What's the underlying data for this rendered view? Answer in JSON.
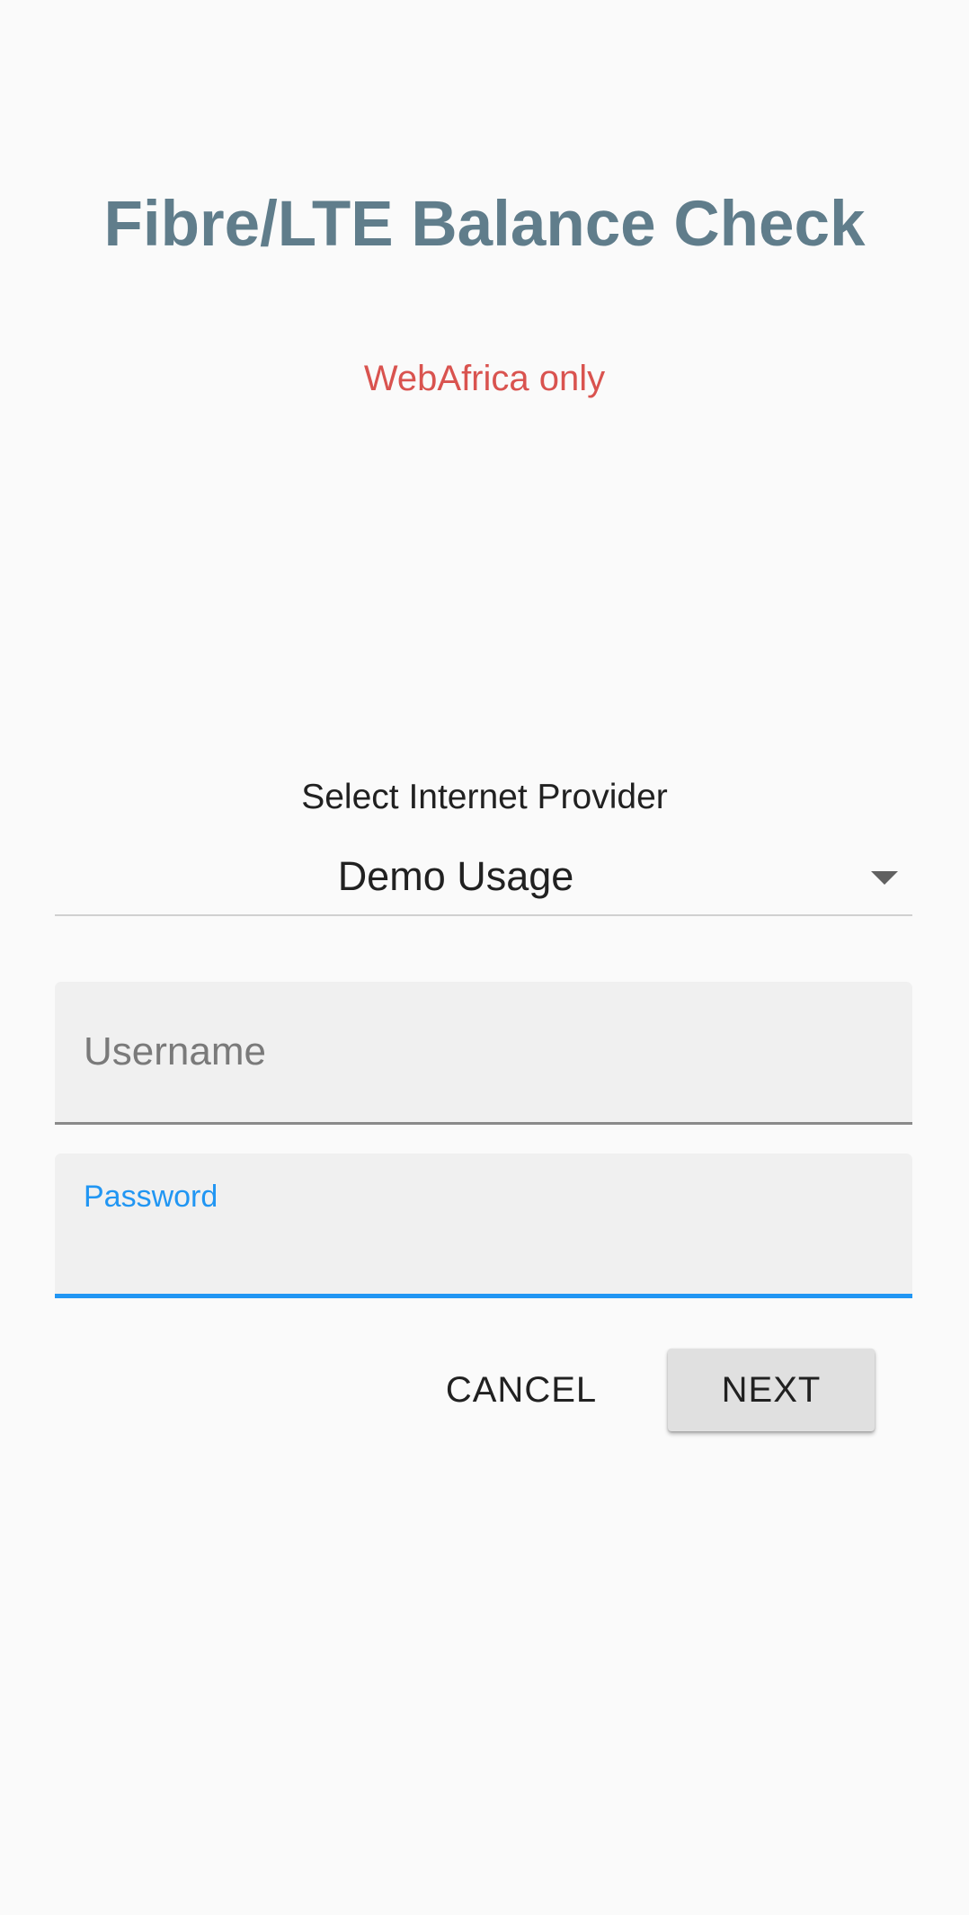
{
  "header": {
    "title": "Fibre/LTE Balance Check",
    "subtitle": "WebAfrica only"
  },
  "provider": {
    "label": "Select Internet Provider",
    "selected": "Demo Usage",
    "arrow_icon": "dropdown-arrow-icon"
  },
  "form": {
    "username_placeholder": "Username",
    "username_value": "",
    "password_label": "Password",
    "password_value": ""
  },
  "actions": {
    "cancel_label": "CANCEL",
    "next_label": "NEXT"
  },
  "colors": {
    "title": "#607d8b",
    "subtitle": "#d9534f",
    "accent": "#2196f3",
    "background": "#fafafa"
  }
}
